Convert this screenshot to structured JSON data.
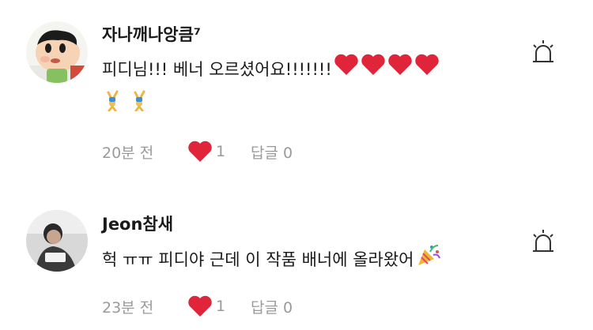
{
  "comments": [
    {
      "author": "자나깨나앙큼⁷",
      "text": "피디님!!! 베너 오르셨어요!!!!!!!",
      "time": "20분 전",
      "likes": "1",
      "replies": "답글 0",
      "emoji_line": [
        "gymnast-icon",
        "gymnast-icon"
      ],
      "trailing_emoji": [
        "heart-icon",
        "heart-icon",
        "heart-icon",
        "heart-icon"
      ]
    },
    {
      "author": "Jeon참새",
      "text": "헉 ㅠㅠ 피디야 근데 이 작품 배너에 올라왔어",
      "time": "23분 전",
      "likes": "1",
      "replies": "답글 0",
      "trailing_emoji": [
        "party-popper-icon"
      ]
    }
  ],
  "colors": {
    "heart": "#e0243a",
    "meta_text": "#9a9a9a",
    "author_text": "#1a1a1a"
  }
}
